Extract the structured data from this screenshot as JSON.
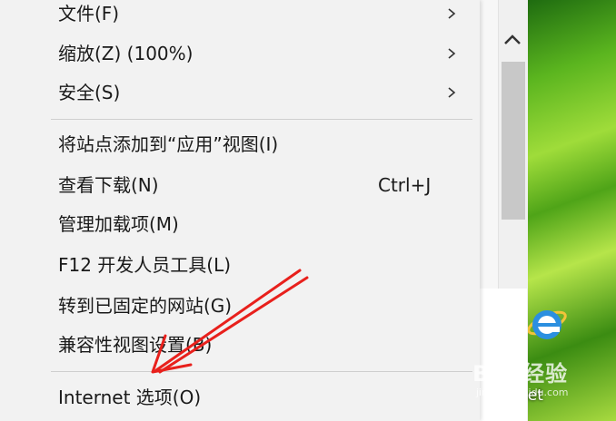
{
  "menu": {
    "items": [
      {
        "label": "文件(F)",
        "submenu": true
      },
      {
        "label": "缩放(Z) (100%)",
        "submenu": true
      },
      {
        "label": "安全(S)",
        "submenu": true
      },
      {
        "label": "将站点添加到“应用”视图(I)"
      },
      {
        "label": "查看下载(N)",
        "shortcut": "Ctrl+J"
      },
      {
        "label": "管理加载项(M)"
      },
      {
        "label": "F12 开发人员工具(L)"
      },
      {
        "label": "转到已固定的网站(G)"
      },
      {
        "label": "兼容性视图设置(B)"
      },
      {
        "label": "Internet 选项(O)"
      }
    ]
  },
  "desktop": {
    "icon_label": "net"
  },
  "watermark": {
    "text": "Bai 经验",
    "sub": "jingyan.baidu.com"
  },
  "annotation": {
    "arrow_color": "#e8201c"
  }
}
